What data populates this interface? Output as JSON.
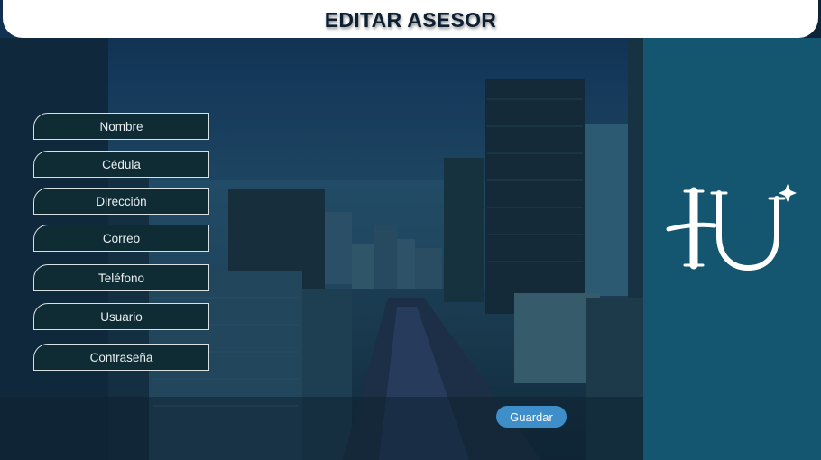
{
  "header": {
    "title": "EDITAR ASESOR"
  },
  "form": {
    "fields": [
      {
        "placeholder": "Nombre"
      },
      {
        "placeholder": "Cédula"
      },
      {
        "placeholder": "Dirección"
      },
      {
        "placeholder": "Correo"
      },
      {
        "placeholder": "Teléfono"
      },
      {
        "placeholder": "Usuario"
      },
      {
        "placeholder": "Contraseña"
      }
    ],
    "save_label": "Guardar"
  },
  "colors": {
    "header_bg": "#ffffff",
    "header_text": "#0d2033",
    "side_panel": "#14566f",
    "field_bg": "#0f2c34",
    "field_border": "#d8e0e2",
    "button": "#3d8ec9"
  },
  "logo": {
    "icon": "hu-monogram-logo"
  }
}
